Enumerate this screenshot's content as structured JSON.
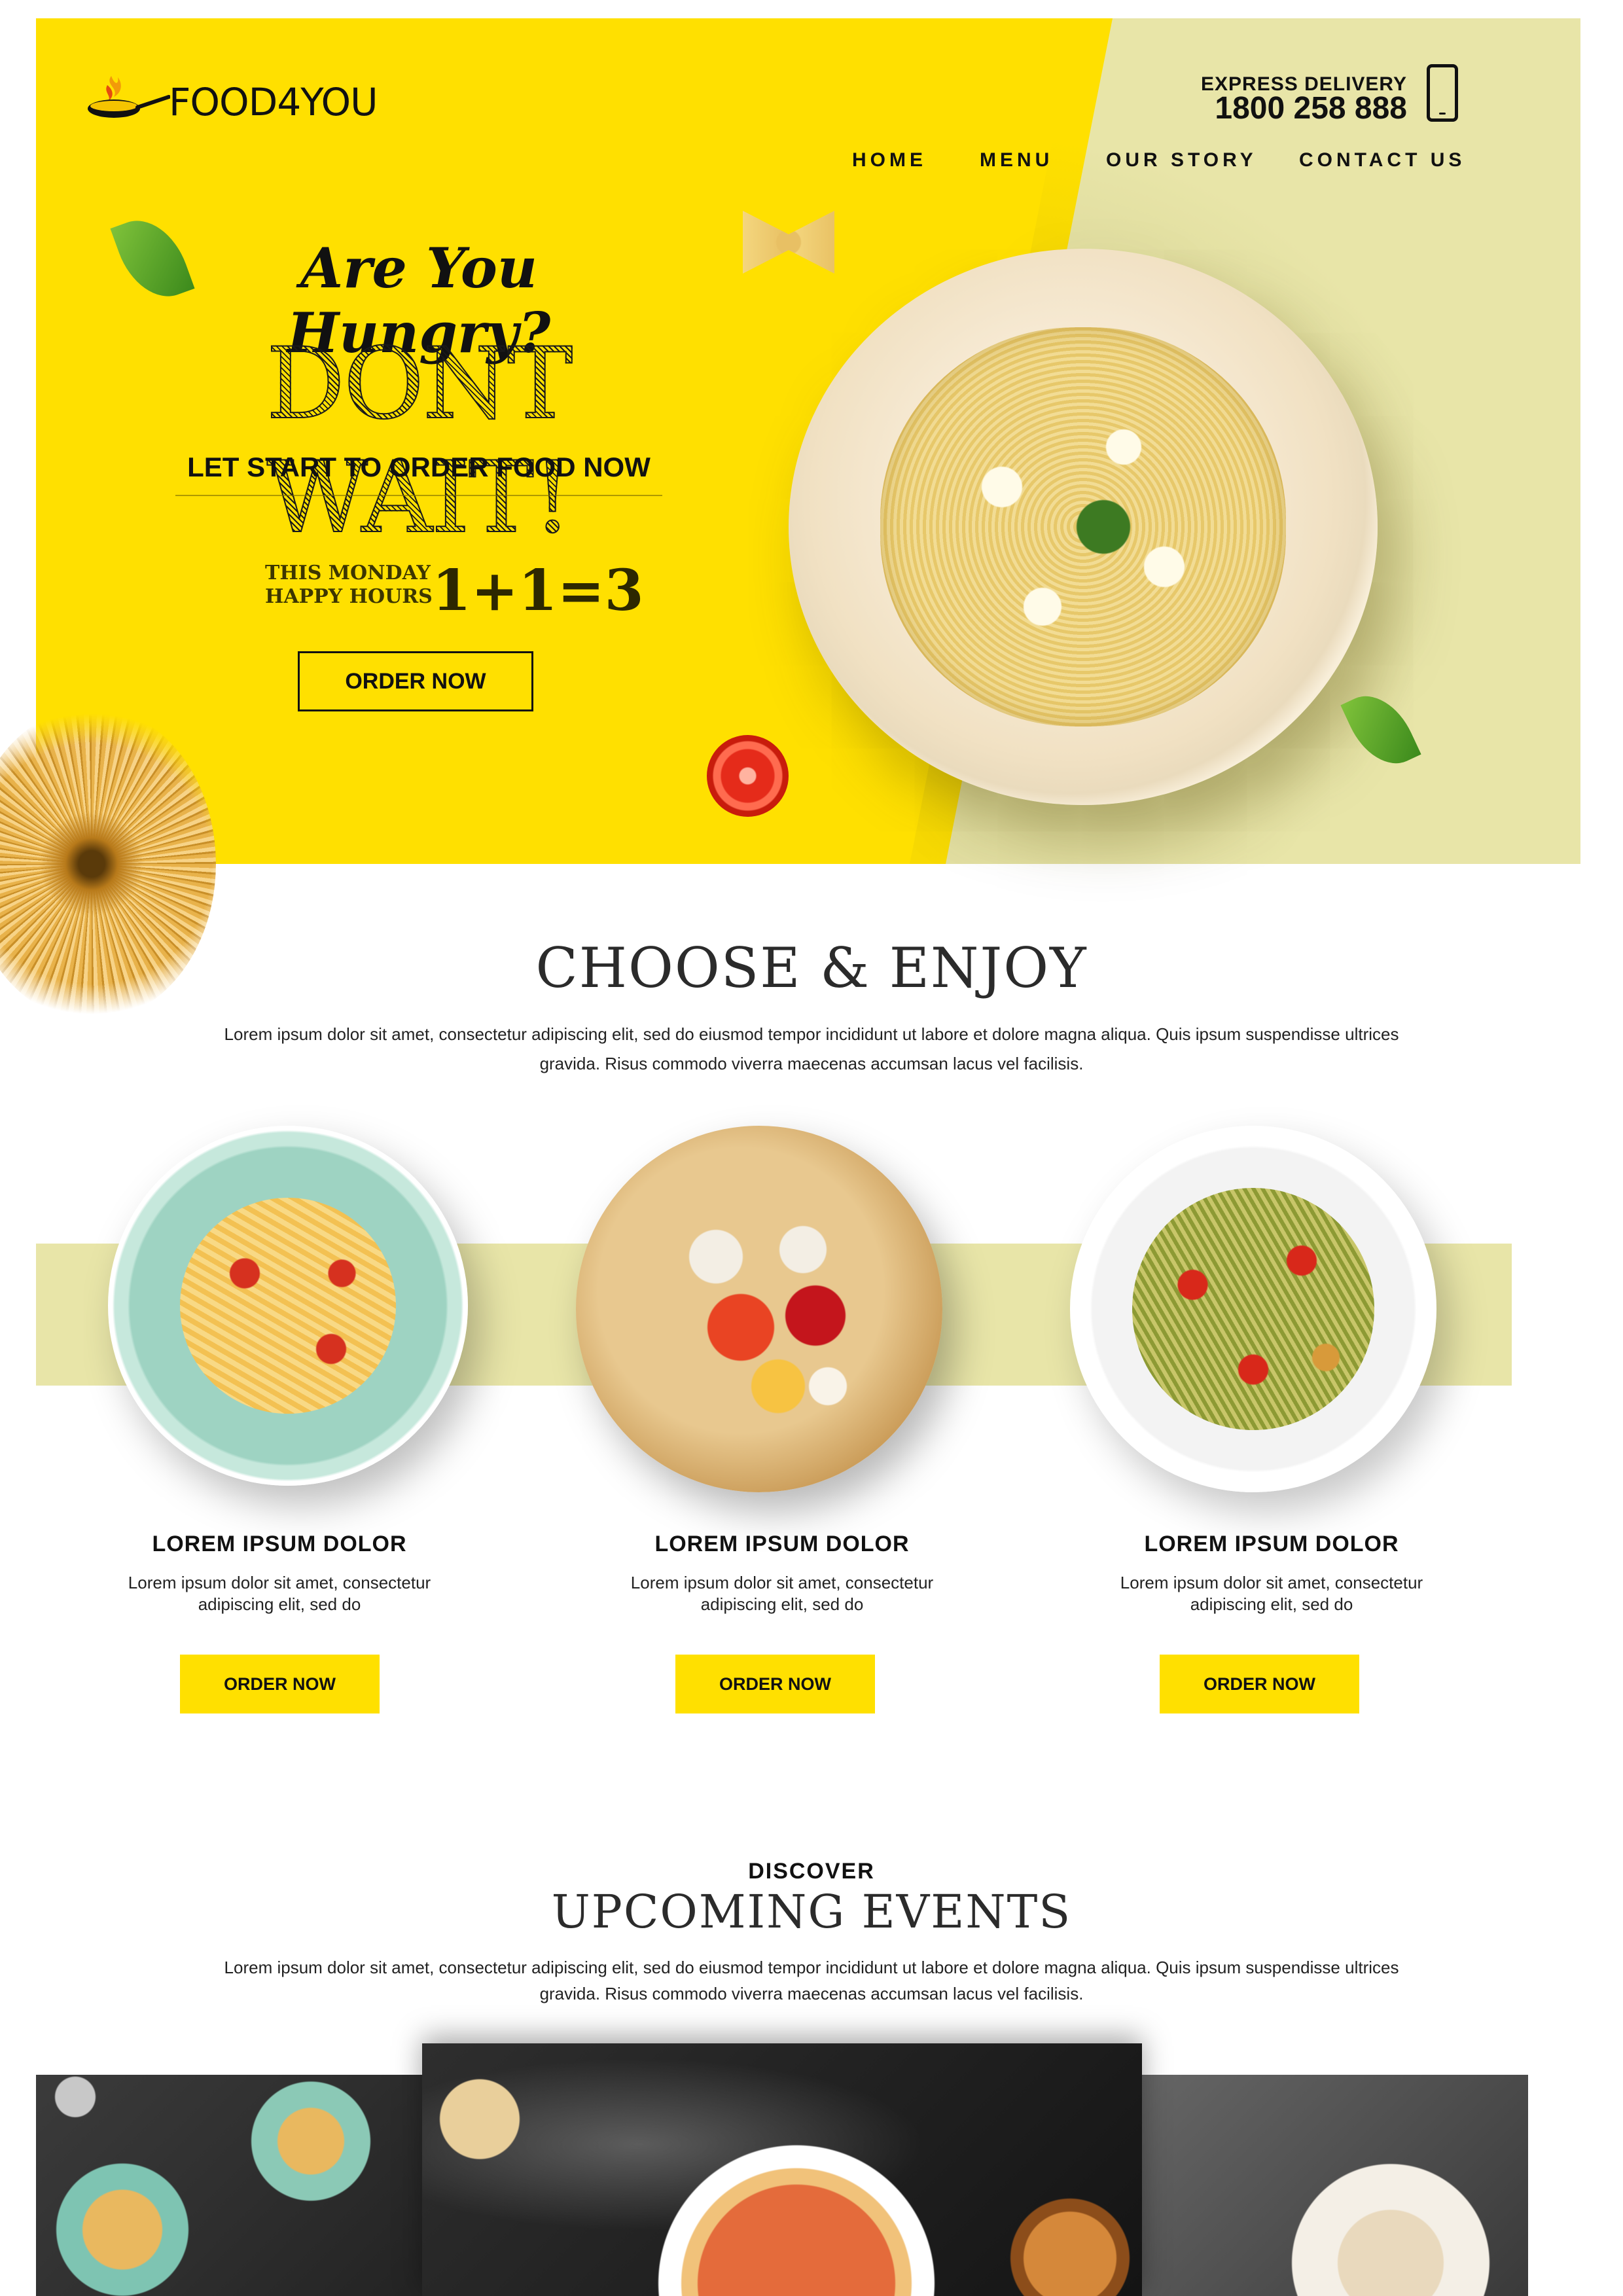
{
  "brand": {
    "name": "FOOD4YOU"
  },
  "header": {
    "express_label": "EXPRESS DELIVERY",
    "phone": "1800 258 888",
    "nav": [
      "HOME",
      "MENU",
      "OUR STORY",
      "CONTACT US"
    ]
  },
  "hero": {
    "tagline": "Are You Hungry?",
    "headline": "DONT WAIT!",
    "subheadline": "LET START TO ORDER FOOD NOW",
    "promo_line1": "THIS MONDAY",
    "promo_line2": "HAPPY HOURS",
    "promo_offer": "1+1=3",
    "cta": "ORDER NOW"
  },
  "choose": {
    "title": "CHOOSE & ENJOY",
    "description": "Lorem ipsum dolor sit amet, consectetur adipiscing elit, sed do eiusmod tempor incididunt ut labore et dolore magna aliqua. Quis ipsum suspendisse ultrices gravida. Risus commodo viverra maecenas accumsan lacus vel facilisis.",
    "cards": [
      {
        "title": "LOREM IPSUM DOLOR",
        "description": "Lorem ipsum dolor sit amet, consectetur adipiscing elit, sed do",
        "cta": "ORDER NOW"
      },
      {
        "title": "LOREM IPSUM DOLOR",
        "description": "Lorem ipsum dolor sit amet, consectetur adipiscing elit, sed do",
        "cta": "ORDER NOW"
      },
      {
        "title": "LOREM IPSUM DOLOR",
        "description": "Lorem ipsum dolor sit amet, consectetur adipiscing elit, sed do",
        "cta": "ORDER NOW"
      }
    ]
  },
  "events": {
    "kicker": "DISCOVER",
    "title": "UPCOMING EVENTS",
    "description": "Lorem ipsum dolor sit amet, consectetur adipiscing elit, sed do eiusmod tempor incididunt ut labore et dolore magna aliqua. Quis ipsum suspendisse ultrices gravida. Risus commodo viverra maecenas accumsan lacus vel facilisis."
  },
  "colors": {
    "accent": "#FFE000",
    "secondary": "#E8E5A8",
    "text": "#111111"
  },
  "icons": [
    "flaming-pan-logo-icon",
    "smartphone-icon"
  ]
}
